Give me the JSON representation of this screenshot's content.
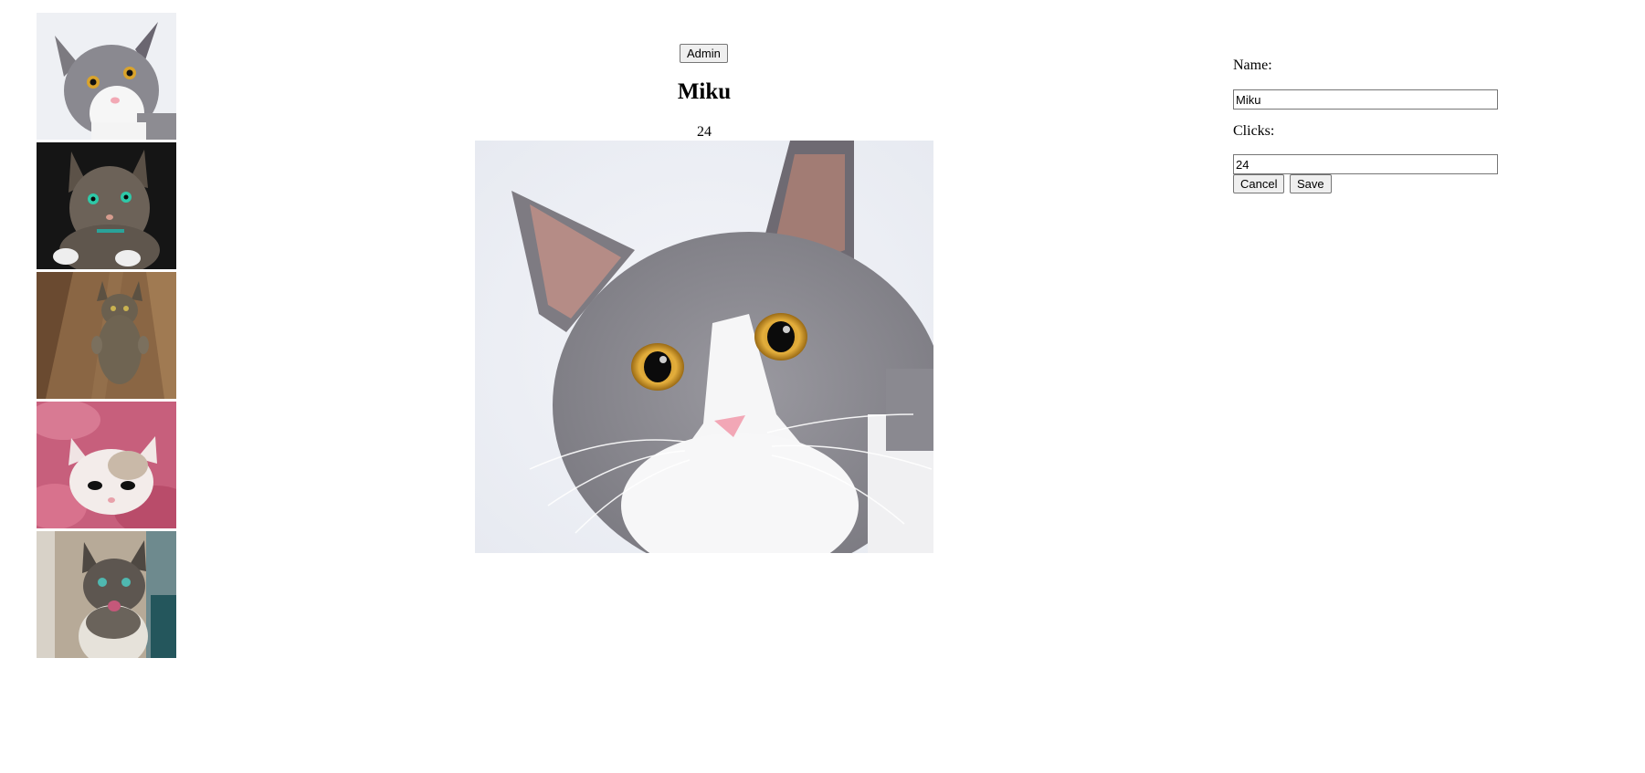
{
  "cat_list": {
    "items": [
      {
        "name": "Miku",
        "icon": "gray-white-cat-photo"
      },
      {
        "name": "",
        "icon": "tabby-cat-dark-photo"
      },
      {
        "name": "",
        "icon": "tabby-cat-standing-photo"
      },
      {
        "name": "",
        "icon": "kitten-pink-blanket-photo"
      },
      {
        "name": "",
        "icon": "tabby-cat-meowing-photo"
      }
    ]
  },
  "display": {
    "admin_label": "Admin",
    "name": "Miku",
    "clicks": "24",
    "image_icon": "gray-white-cat-photo"
  },
  "admin": {
    "name_label": "Name:",
    "name_value": "Miku",
    "clicks_label": "Clicks:",
    "clicks_value": "24",
    "cancel_label": "Cancel",
    "save_label": "Save"
  }
}
